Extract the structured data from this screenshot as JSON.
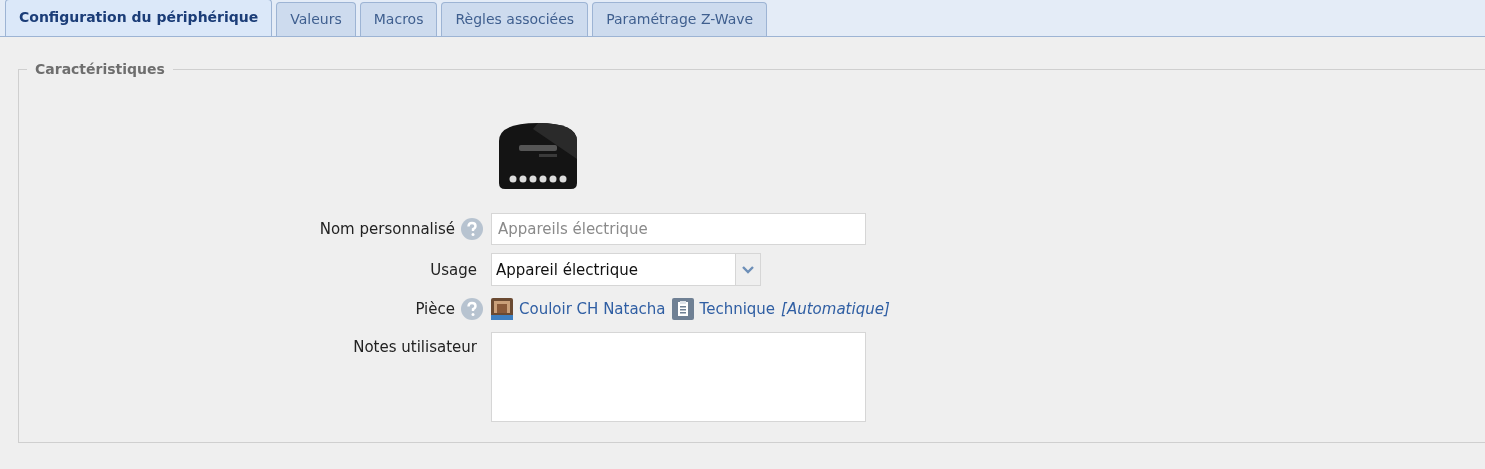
{
  "tabs": [
    {
      "label": "Configuration du périphérique",
      "selected": true
    },
    {
      "label": "Valeurs",
      "selected": false
    },
    {
      "label": "Macros",
      "selected": false
    },
    {
      "label": "Règles associées",
      "selected": false
    },
    {
      "label": "Paramétrage Z-Wave",
      "selected": false
    }
  ],
  "section": {
    "legend": "Caractéristiques",
    "fields": [
      {
        "kind": "text",
        "label": "Nom personnalisé",
        "help": true,
        "placeholder": "Appareils électrique"
      },
      {
        "kind": "select",
        "label": "Usage",
        "help": false,
        "value": "Appareil électrique"
      },
      {
        "kind": "room",
        "label": "Pièce",
        "help": true,
        "room": "Couloir CH Natacha",
        "category": "Technique",
        "note": "[Automatique]"
      },
      {
        "kind": "textarea",
        "label": "Notes utilisateur",
        "help": false
      }
    ]
  }
}
